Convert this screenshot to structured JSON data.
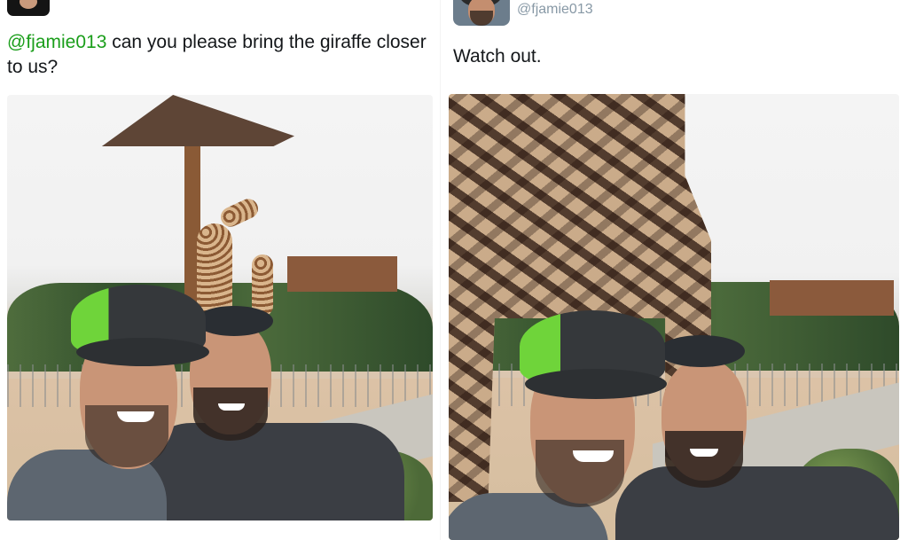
{
  "left_tweet": {
    "mention": "@fjamie013",
    "text": " can you please bring the giraffe closer to us?"
  },
  "right_tweet": {
    "handle": "@fjamie013",
    "text": "Watch out."
  },
  "colors": {
    "mention": "#1b9e1b",
    "handle": "#8899a6",
    "text": "#14171a"
  }
}
